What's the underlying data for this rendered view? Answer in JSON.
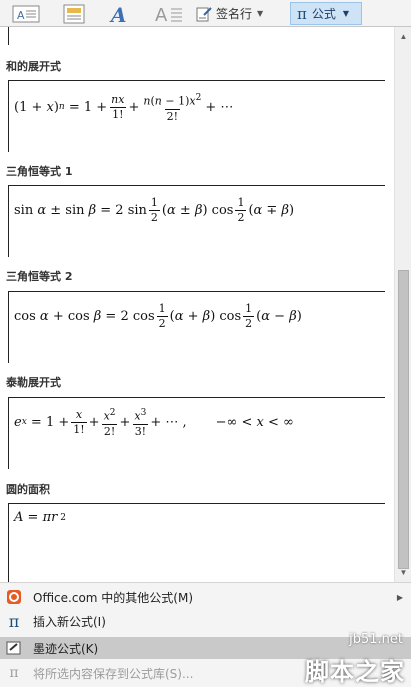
{
  "ribbon": {
    "signature_label": "签名行",
    "formula_label": "公式",
    "formula_symbol": "π"
  },
  "sections": [
    {
      "title": "和的展开式"
    },
    {
      "title": "三角恒等式 1"
    },
    {
      "title": "三角恒等式 2"
    },
    {
      "title": "泰勒展开式"
    },
    {
      "title": "圆的面积"
    }
  ],
  "menu": {
    "items": [
      {
        "label": "Office.com 中的其他公式(M)"
      },
      {
        "label": "插入新公式(I)"
      },
      {
        "label": "墨迹公式(K)"
      },
      {
        "label": "将所选内容保存到公式库(S)..."
      }
    ]
  },
  "watermark": {
    "site": "jb51.net",
    "name": "脚本之家"
  },
  "colors": {
    "accent": "#cfe3f7",
    "menu_hover": "#c9c9c9",
    "disabled_text": "#9c9c9c"
  }
}
